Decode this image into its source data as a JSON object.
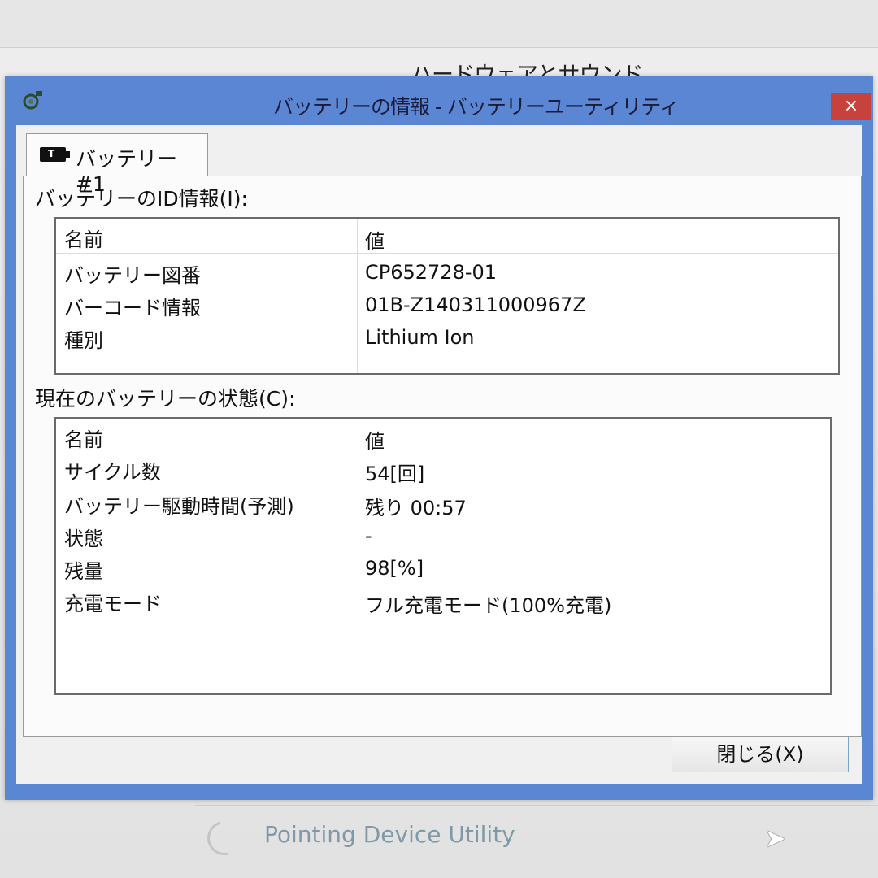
{
  "background": {
    "window_title": "ハードウェアとサウンド",
    "bottom_item": "Pointing Device Utility"
  },
  "dialog": {
    "title": "バッテリーの情報 - バッテリーユーティリティ",
    "close_glyph": "×",
    "tab_label": "バッテリー #1",
    "tab_icon_glyph": "T",
    "id_group": {
      "label": "バッテリーのID情報(I):",
      "header": {
        "name": "名前",
        "value": "値"
      },
      "rows": [
        {
          "name": "バッテリー図番",
          "value": "CP652728-01"
        },
        {
          "name": "バーコード情報",
          "value": "01B-Z140311000967Z"
        },
        {
          "name": "種別",
          "value": "Lithium Ion"
        }
      ]
    },
    "status_group": {
      "label": "現在のバッテリーの状態(C):",
      "header": {
        "name": "名前",
        "value": "値"
      },
      "rows": [
        {
          "name": "サイクル数",
          "value": "54[回]"
        },
        {
          "name": "バッテリー駆動時間(予測)",
          "value": "残り 00:57"
        },
        {
          "name": "状態",
          "value": "-"
        },
        {
          "name": "残量",
          "value": "98[%]"
        },
        {
          "name": "充電モード",
          "value": "フル充電モード(100%充電)"
        }
      ]
    },
    "close_button_label": "閉じる(X)"
  },
  "colors": {
    "dialog_frame": "#5b86d4",
    "close_red": "#c7423c"
  }
}
